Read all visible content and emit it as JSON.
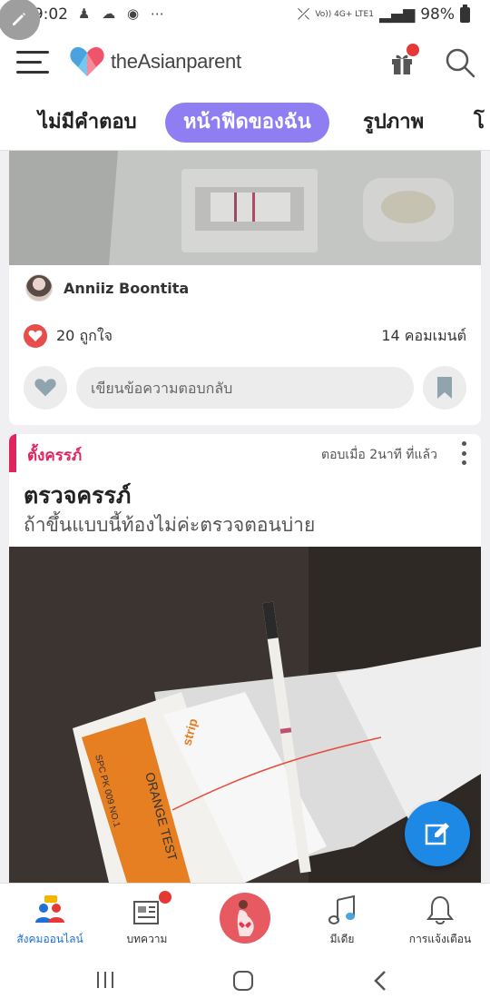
{
  "status_bar": {
    "time": "09:02",
    "network": "Vo)) 4G+ LTE1",
    "battery": "98%"
  },
  "header": {
    "logo_text": "theAsianparent"
  },
  "tabs": [
    {
      "label": "ไม่มีคำตอบ",
      "active": false
    },
    {
      "label": "หน้าฟีดของฉัน",
      "active": true
    },
    {
      "label": "รูปภาพ",
      "active": false
    },
    {
      "label": "โ",
      "active": false
    }
  ],
  "post1": {
    "author": "Anniiz Boontita",
    "likes": "20 ถูกใจ",
    "comments": "14 คอมเมนต์",
    "reply_placeholder": "เขียนข้อความตอบกลับ"
  },
  "post2": {
    "category": "ตั้งครรภ์",
    "time": "ตอบเมื่อ 2นาที ที่แล้ว",
    "title": "ตรวจครรภ์",
    "subtitle": "ถ้าขึ้นแบบนี้ท้องไม่ค่ะตรวจตอนบ่าย",
    "photo_text": {
      "brand": "strip",
      "product": "ORANGE TEST",
      "code": "SPC PK 009 NO.1"
    }
  },
  "bottom_nav": [
    {
      "label": "สังคมออนไลน์",
      "icon": "community-icon",
      "active": true
    },
    {
      "label": "บทความ",
      "icon": "article-icon",
      "active": false
    },
    {
      "label": "",
      "icon": "pregnancy-icon",
      "active": false
    },
    {
      "label": "มีเดีย",
      "icon": "music-icon",
      "active": false
    },
    {
      "label": "การแจ้งเตือน",
      "icon": "bell-icon",
      "active": false
    }
  ],
  "colors": {
    "accent_tab": "#8e7ef2",
    "category": "#e0245e",
    "fab": "#1e88e5",
    "like": "#e54e4b",
    "nav_active": "#1e6fd9"
  }
}
